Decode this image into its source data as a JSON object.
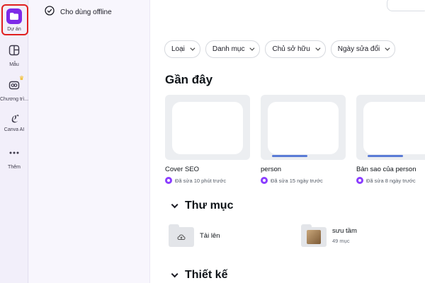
{
  "rail": {
    "items": [
      {
        "label": "Dự án",
        "icon": "folder-icon"
      },
      {
        "label": "Mẫu",
        "icon": "template-icon"
      },
      {
        "label": "Chương trì...",
        "icon": "brand-kit-icon"
      },
      {
        "label": "Canva AI",
        "icon": "canva-ai-icon"
      },
      {
        "label": "Thêm",
        "icon": "more-icon"
      }
    ]
  },
  "panel": {
    "offline_label": "Cho dùng offline"
  },
  "filters": [
    {
      "label": "Loại"
    },
    {
      "label": "Danh mục"
    },
    {
      "label": "Chủ sở hữu"
    },
    {
      "label": "Ngày sửa đổi"
    }
  ],
  "recent": {
    "heading": "Gần đây",
    "cards": [
      {
        "title": "Cover SEO",
        "meta": "Đã sửa 10 phút trước"
      },
      {
        "title": "person",
        "meta": "Đã sửa 15 ngày trước"
      },
      {
        "title": "Bản sao của person",
        "meta": "Đã sửa 8 ngày trước"
      }
    ]
  },
  "folders": {
    "heading": "Thư mục",
    "items": [
      {
        "name": "Tải lên",
        "count": ""
      },
      {
        "name": "sưu tầm",
        "count": "49 mục"
      }
    ]
  },
  "designs": {
    "heading": "Thiết kế"
  },
  "colors": {
    "accent": "#7d2ae8",
    "highlight": "#e02020",
    "crown": "#f2b300"
  }
}
